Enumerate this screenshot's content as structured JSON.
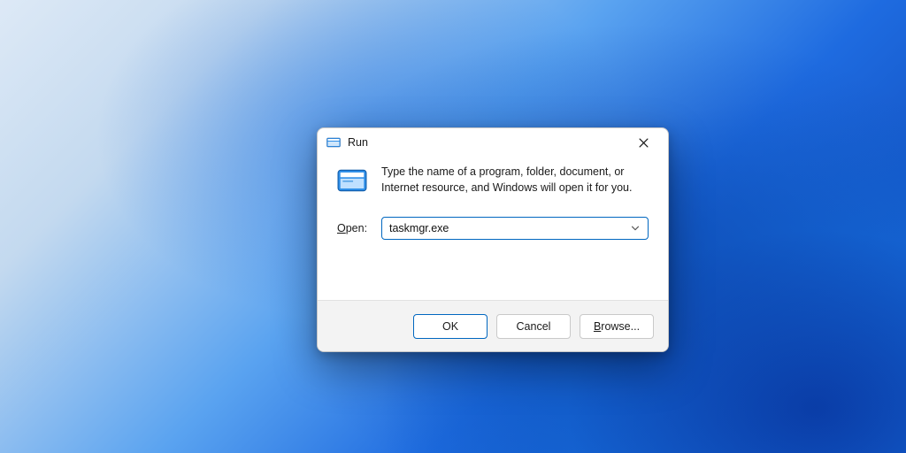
{
  "dialog": {
    "title": "Run",
    "description": "Type the name of a program, folder, document, or Internet resource, and Windows will open it for you.",
    "open_label_underlined": "O",
    "open_label_rest": "pen:",
    "input_value": "taskmgr.exe",
    "buttons": {
      "ok": "OK",
      "cancel": "Cancel",
      "browse_underlined": "B",
      "browse_rest": "rowse..."
    }
  }
}
